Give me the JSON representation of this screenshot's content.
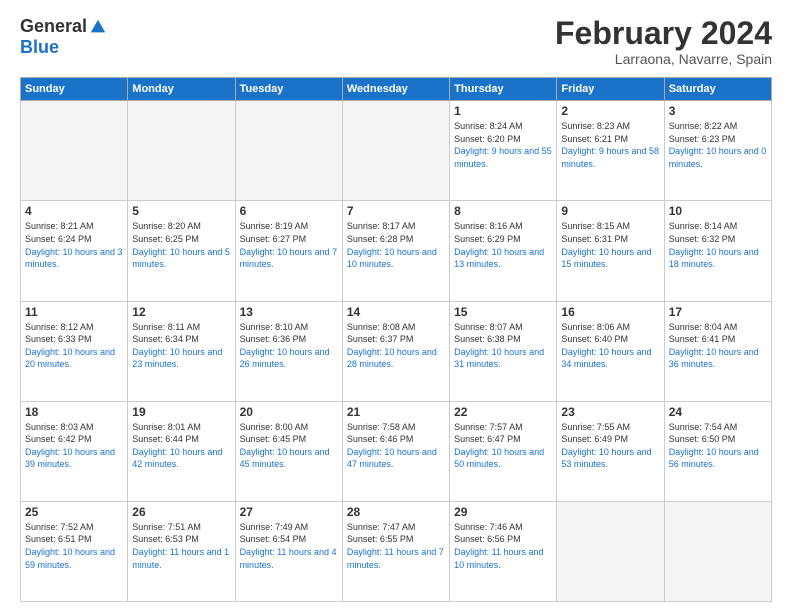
{
  "header": {
    "logo_general": "General",
    "logo_blue": "Blue",
    "month": "February 2024",
    "location": "Larraona, Navarre, Spain"
  },
  "weekdays": [
    "Sunday",
    "Monday",
    "Tuesday",
    "Wednesday",
    "Thursday",
    "Friday",
    "Saturday"
  ],
  "weeks": [
    [
      {
        "day": "",
        "empty": true
      },
      {
        "day": "",
        "empty": true
      },
      {
        "day": "",
        "empty": true
      },
      {
        "day": "",
        "empty": true
      },
      {
        "day": "1",
        "sunrise": "8:24 AM",
        "sunset": "6:20 PM",
        "daylight": "9 hours and 55 minutes."
      },
      {
        "day": "2",
        "sunrise": "8:23 AM",
        "sunset": "6:21 PM",
        "daylight": "9 hours and 58 minutes."
      },
      {
        "day": "3",
        "sunrise": "8:22 AM",
        "sunset": "6:23 PM",
        "daylight": "10 hours and 0 minutes."
      }
    ],
    [
      {
        "day": "4",
        "sunrise": "8:21 AM",
        "sunset": "6:24 PM",
        "daylight": "10 hours and 3 minutes."
      },
      {
        "day": "5",
        "sunrise": "8:20 AM",
        "sunset": "6:25 PM",
        "daylight": "10 hours and 5 minutes."
      },
      {
        "day": "6",
        "sunrise": "8:19 AM",
        "sunset": "6:27 PM",
        "daylight": "10 hours and 7 minutes."
      },
      {
        "day": "7",
        "sunrise": "8:17 AM",
        "sunset": "6:28 PM",
        "daylight": "10 hours and 10 minutes."
      },
      {
        "day": "8",
        "sunrise": "8:16 AM",
        "sunset": "6:29 PM",
        "daylight": "10 hours and 13 minutes."
      },
      {
        "day": "9",
        "sunrise": "8:15 AM",
        "sunset": "6:31 PM",
        "daylight": "10 hours and 15 minutes."
      },
      {
        "day": "10",
        "sunrise": "8:14 AM",
        "sunset": "6:32 PM",
        "daylight": "10 hours and 18 minutes."
      }
    ],
    [
      {
        "day": "11",
        "sunrise": "8:12 AM",
        "sunset": "6:33 PM",
        "daylight": "10 hours and 20 minutes."
      },
      {
        "day": "12",
        "sunrise": "8:11 AM",
        "sunset": "6:34 PM",
        "daylight": "10 hours and 23 minutes."
      },
      {
        "day": "13",
        "sunrise": "8:10 AM",
        "sunset": "6:36 PM",
        "daylight": "10 hours and 26 minutes."
      },
      {
        "day": "14",
        "sunrise": "8:08 AM",
        "sunset": "6:37 PM",
        "daylight": "10 hours and 28 minutes."
      },
      {
        "day": "15",
        "sunrise": "8:07 AM",
        "sunset": "6:38 PM",
        "daylight": "10 hours and 31 minutes."
      },
      {
        "day": "16",
        "sunrise": "8:06 AM",
        "sunset": "6:40 PM",
        "daylight": "10 hours and 34 minutes."
      },
      {
        "day": "17",
        "sunrise": "8:04 AM",
        "sunset": "6:41 PM",
        "daylight": "10 hours and 36 minutes."
      }
    ],
    [
      {
        "day": "18",
        "sunrise": "8:03 AM",
        "sunset": "6:42 PM",
        "daylight": "10 hours and 39 minutes."
      },
      {
        "day": "19",
        "sunrise": "8:01 AM",
        "sunset": "6:44 PM",
        "daylight": "10 hours and 42 minutes."
      },
      {
        "day": "20",
        "sunrise": "8:00 AM",
        "sunset": "6:45 PM",
        "daylight": "10 hours and 45 minutes."
      },
      {
        "day": "21",
        "sunrise": "7:58 AM",
        "sunset": "6:46 PM",
        "daylight": "10 hours and 47 minutes."
      },
      {
        "day": "22",
        "sunrise": "7:57 AM",
        "sunset": "6:47 PM",
        "daylight": "10 hours and 50 minutes."
      },
      {
        "day": "23",
        "sunrise": "7:55 AM",
        "sunset": "6:49 PM",
        "daylight": "10 hours and 53 minutes."
      },
      {
        "day": "24",
        "sunrise": "7:54 AM",
        "sunset": "6:50 PM",
        "daylight": "10 hours and 56 minutes."
      }
    ],
    [
      {
        "day": "25",
        "sunrise": "7:52 AM",
        "sunset": "6:51 PM",
        "daylight": "10 hours and 59 minutes."
      },
      {
        "day": "26",
        "sunrise": "7:51 AM",
        "sunset": "6:53 PM",
        "daylight": "11 hours and 1 minute."
      },
      {
        "day": "27",
        "sunrise": "7:49 AM",
        "sunset": "6:54 PM",
        "daylight": "11 hours and 4 minutes."
      },
      {
        "day": "28",
        "sunrise": "7:47 AM",
        "sunset": "6:55 PM",
        "daylight": "11 hours and 7 minutes."
      },
      {
        "day": "29",
        "sunrise": "7:46 AM",
        "sunset": "6:56 PM",
        "daylight": "11 hours and 10 minutes."
      },
      {
        "day": "",
        "empty": true
      },
      {
        "day": "",
        "empty": true
      }
    ]
  ]
}
